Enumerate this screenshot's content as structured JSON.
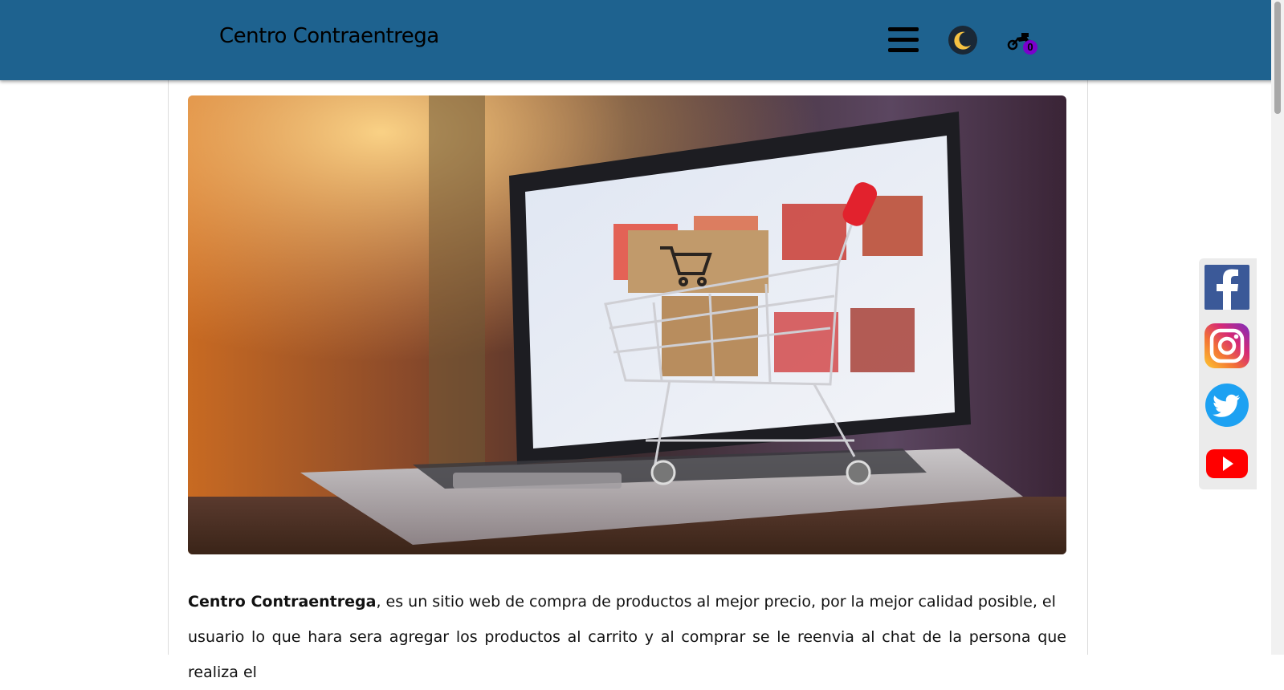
{
  "header": {
    "brand": "Centro Contraentrega",
    "cart_count": "0",
    "colors": {
      "bar": "#1e628f",
      "badge": "#7a00cc"
    },
    "icons": [
      "menu-icon",
      "moon-icon",
      "motorcycle-cart-icon"
    ]
  },
  "hero": {
    "icon": "shopping-cart-on-laptop-image"
  },
  "intro": {
    "brand": "Centro Contraentrega",
    "line1": ", es un sitio web de compra de productos al mejor precio, por la mejor calidad posible, el",
    "line2": "usuario lo que hara sera agregar los productos al carrito y al comprar se le reenvia al chat de la persona que realiza el"
  },
  "social": {
    "items": [
      "facebook-icon",
      "instagram-icon",
      "twitter-icon",
      "youtube-icon"
    ],
    "colors": {
      "facebook": "#3b5998",
      "twitter": "#1da1f2",
      "youtube": "#ff0000"
    }
  }
}
